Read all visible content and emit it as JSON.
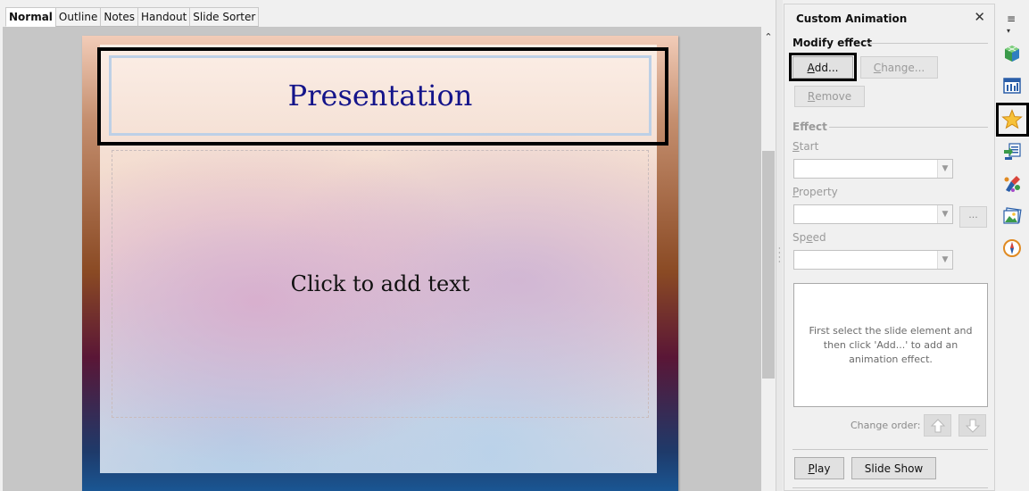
{
  "tabs": [
    "Normal",
    "Outline",
    "Notes",
    "Handout",
    "Slide Sorter"
  ],
  "slide": {
    "title": "Presentation",
    "content": "Click to add text"
  },
  "pane": {
    "title": "Custom Animation",
    "modify_effect": "Modify effect",
    "add": {
      "pre": "",
      "u": "A",
      "post": "dd..."
    },
    "change": {
      "pre": "",
      "u": "C",
      "post": "hange..."
    },
    "remove": {
      "pre": "",
      "u": "R",
      "post": "emove"
    },
    "effect": "Effect",
    "start": {
      "pre": "",
      "u": "S",
      "post": "tart"
    },
    "property": {
      "pre": "",
      "u": "P",
      "post": "roperty"
    },
    "speed": {
      "pre": "Sp",
      "u": "e",
      "post": "ed"
    },
    "dots": "...",
    "hint": "First select the slide element and then click 'Add...' to add an animation effect.",
    "change_order": "Change order:",
    "play": {
      "pre": "",
      "u": "P",
      "post": "lay"
    },
    "slide_show": "Slide Show"
  },
  "sidebar_icons": [
    "menu-icon",
    "properties-cube-icon",
    "slide-layouts-icon",
    "custom-animation-star-icon",
    "slide-transition-icon",
    "styles-icon",
    "gallery-icon",
    "navigator-icon"
  ],
  "colors": {
    "title_text": "#14148a",
    "highlight": "#000000"
  }
}
